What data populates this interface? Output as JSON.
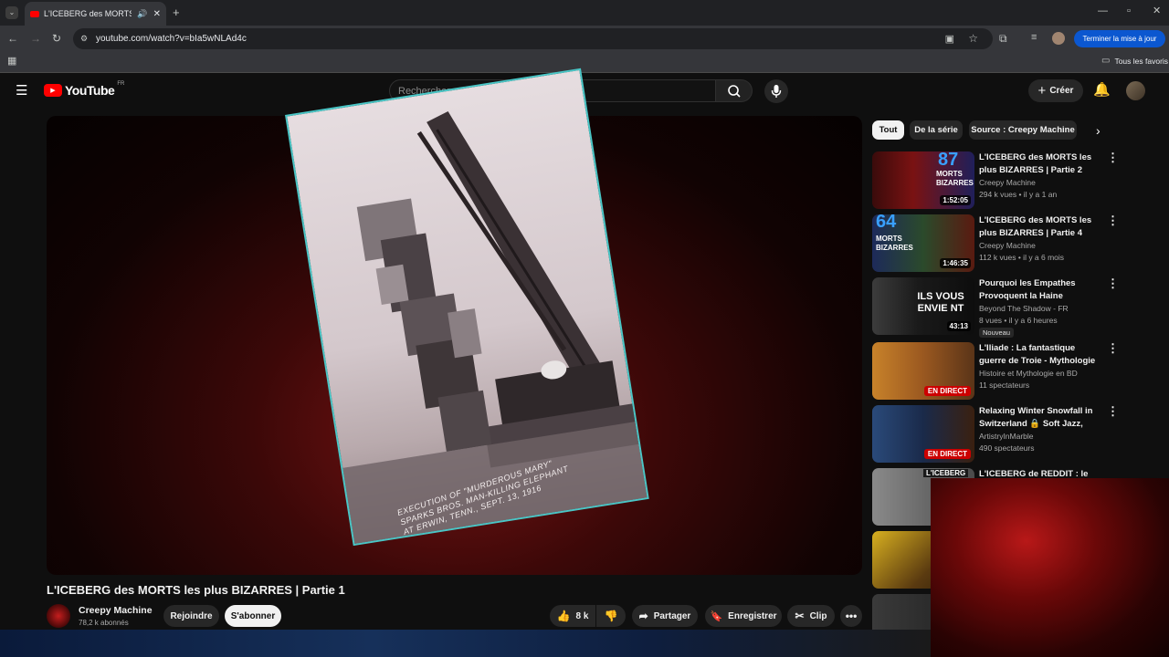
{
  "browser": {
    "tab_title": "L'ICEBERG des MORTS les p",
    "url": "youtube.com/watch?v=bIa5wNLAd4c",
    "update_label": "Terminer la mise à jour",
    "bookmarks_label": "Tous les favoris"
  },
  "youtube": {
    "logo_text": "YouTube",
    "region": "FR",
    "search_placeholder": "Rechercher",
    "create_label": "Créer"
  },
  "video": {
    "title": "L'ICEBERG des MORTS les plus BIZARRES | Partie 1",
    "photo_caption": [
      "EXECUTION OF \"MURDEROUS MARY\"",
      "SPARKS BROS. MAN-KILLING ELEPHANT",
      "AT ERWIN, TENN., SEPT. 13, 1916"
    ],
    "channel_name": "Creepy Machine",
    "subscribers": "78,2 k abonnés",
    "join_label": "Rejoindre",
    "subscribe_label": "S'abonner",
    "likes": "8 k",
    "share_label": "Partager",
    "save_label": "Enregistrer",
    "clip_label": "Clip"
  },
  "sidebar": {
    "chips": [
      "Tout",
      "De la série",
      "Source : Creepy Machine"
    ],
    "items": [
      {
        "title": "L'ICEBERG des MORTS les plus BIZARRES | Partie 2",
        "channel": "Creepy Machine",
        "meta": "294 k vues • il y a 1 an",
        "duration": "1:52:05",
        "thumb_text": "MORTS BIZARRES",
        "thumb_number": "87"
      },
      {
        "title": "L'ICEBERG des MORTS les plus BIZARRES | Partie 4",
        "channel": "Creepy Machine",
        "meta": "112 k vues • il y a 6 mois",
        "duration": "1:46:35",
        "thumb_text": "MORTS BIZARRES",
        "thumb_number": "64"
      },
      {
        "title": "Pourquoi les Empathes Provoquent la Haine Silencieu…",
        "channel": "Beyond The Shadow - FR",
        "meta": "8 vues • il y a 6 heures",
        "duration": "43:13",
        "badge": "Nouveau",
        "thumb_text": "ILS VOUS ENVIE NT"
      },
      {
        "title": "L'Iliade : La fantastique guerre de Troie - Mythologie grecque",
        "channel": "Histoire et Mythologie en BD",
        "meta": "11 spectateurs",
        "live": "EN DIRECT"
      },
      {
        "title": "Relaxing Winter Snowfall in Switzerland 🔒 Soft Jazz, Coz…",
        "channel": "ArtistryInMarble",
        "meta": "490 spectateurs",
        "live": "EN DIRECT"
      },
      {
        "title": "L'ICEBERG de REDDIT : le site le",
        "thumb_text": "L'ICEBERG"
      }
    ]
  }
}
